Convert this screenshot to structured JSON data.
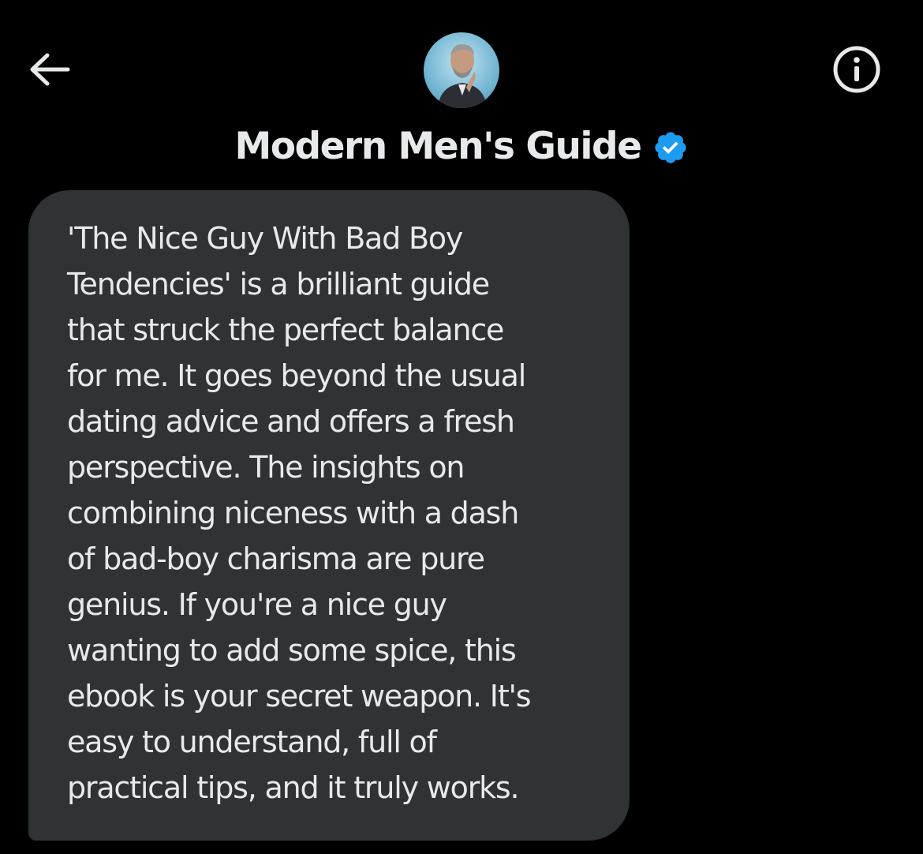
{
  "header": {
    "back_icon": "arrow-left-icon",
    "info_icon": "info-circle-icon",
    "display_name": "Modern Men's Guide",
    "verified_icon": "verified-badge-icon",
    "avatar_description": "avatar",
    "colors": {
      "background": "#000000",
      "text": "#e7e9ea",
      "verified_badge": "#1d9bf0"
    }
  },
  "message": {
    "bubble_color": "#2f3336",
    "lines": [
      "'The Nice Guy With Bad Boy",
      "Tendencies' is a brilliant guide",
      "that struck the perfect balance",
      "for me. It goes beyond the usual",
      "dating advice and offers a fresh",
      "perspective. The insights on",
      "combining niceness with a dash",
      "of bad-boy charisma are pure",
      "genius. If you're a nice guy",
      "wanting to add some spice, this",
      "ebook is your secret weapon. It's",
      "easy to understand, full of",
      "practical tips, and it truly works."
    ]
  }
}
